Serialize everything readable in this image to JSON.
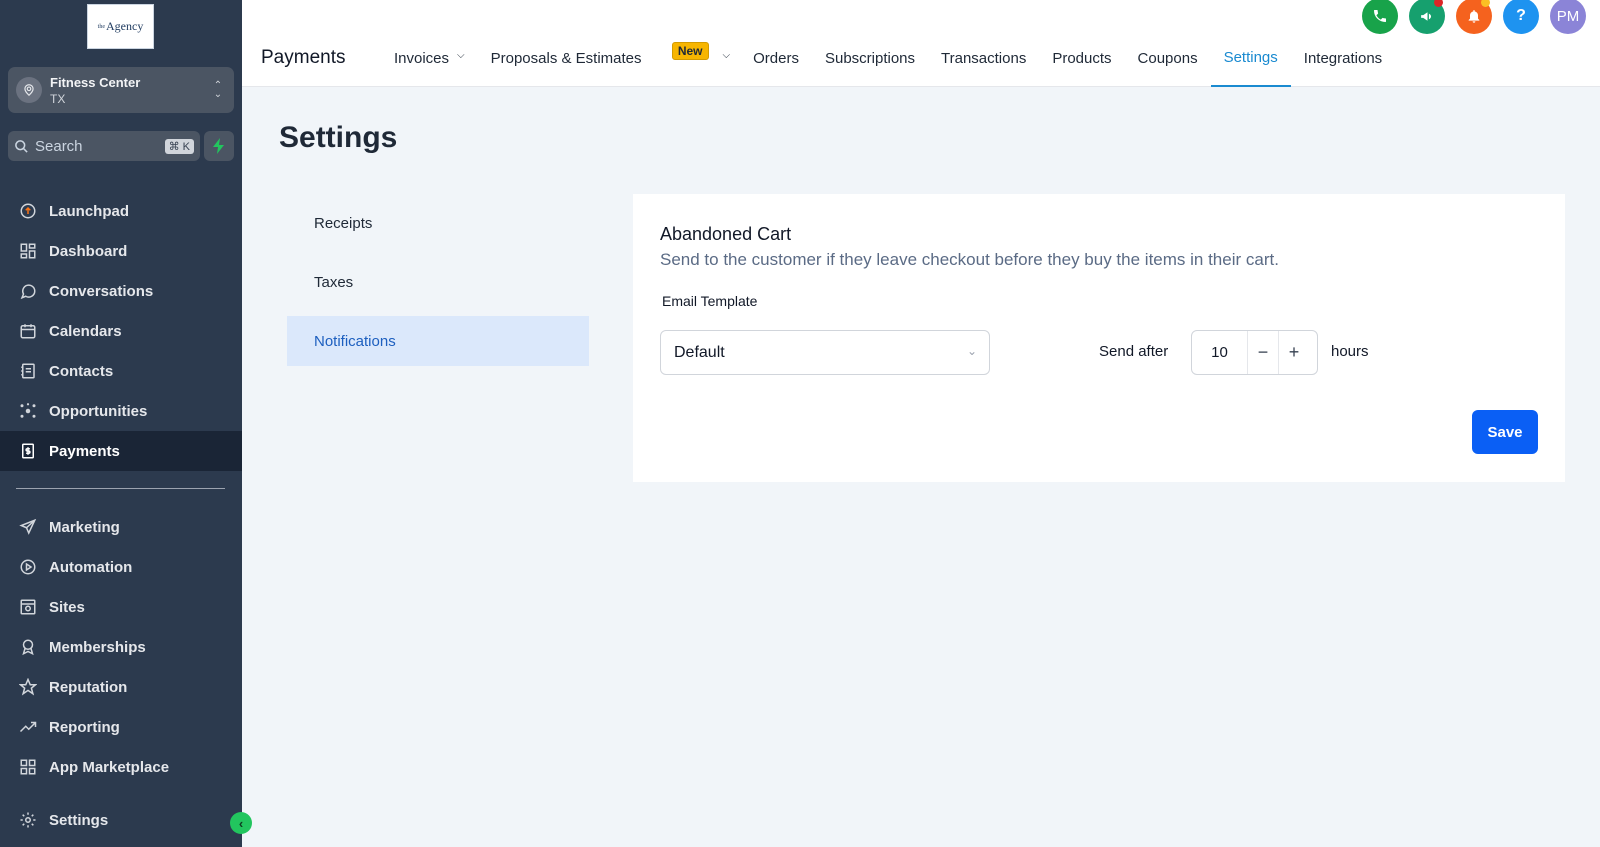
{
  "brand": {
    "logo_small": "the",
    "logo_text": "Agency"
  },
  "account": {
    "name": "Fitness Center",
    "location": "TX"
  },
  "search": {
    "placeholder": "Search",
    "shortcut": "⌘ K"
  },
  "sidebar": {
    "items": [
      {
        "label": "Launchpad",
        "icon": "launchpad-icon"
      },
      {
        "label": "Dashboard",
        "icon": "dashboard-icon"
      },
      {
        "label": "Conversations",
        "icon": "chat-icon"
      },
      {
        "label": "Calendars",
        "icon": "calendar-icon"
      },
      {
        "label": "Contacts",
        "icon": "contacts-icon"
      },
      {
        "label": "Opportunities",
        "icon": "opportunities-icon"
      },
      {
        "label": "Payments",
        "icon": "payments-icon",
        "active": true
      }
    ],
    "items2": [
      {
        "label": "Marketing",
        "icon": "send-icon"
      },
      {
        "label": "Automation",
        "icon": "automation-icon"
      },
      {
        "label": "Sites",
        "icon": "sites-icon"
      },
      {
        "label": "Memberships",
        "icon": "membership-icon"
      },
      {
        "label": "Reputation",
        "icon": "star-icon"
      },
      {
        "label": "Reporting",
        "icon": "reporting-icon"
      },
      {
        "label": "App Marketplace",
        "icon": "apps-icon"
      }
    ],
    "settings_label": "Settings"
  },
  "header": {
    "title": "Payments",
    "tabs": [
      {
        "label": "Invoices"
      },
      {
        "label": "Proposals & Estimates",
        "badge": "New"
      },
      {
        "label": "Orders"
      },
      {
        "label": "Subscriptions"
      },
      {
        "label": "Transactions"
      },
      {
        "label": "Products"
      },
      {
        "label": "Coupons"
      },
      {
        "label": "Settings",
        "active": true
      },
      {
        "label": "Integrations"
      }
    ],
    "avatar_initials": "PM",
    "help_glyph": "?"
  },
  "colors": {
    "sidebar_bg": "#2c3a4e",
    "accent": "#1a8ad0",
    "save_button": "#0a5ff5",
    "phone": "#18a34a",
    "announce": "#16a06e",
    "bell": "#f5621e",
    "help": "#1e93f0",
    "avatar": "#8b84d7"
  },
  "page": {
    "title": "Settings",
    "subnav": [
      {
        "label": "Receipts"
      },
      {
        "label": "Taxes"
      },
      {
        "label": "Notifications",
        "active": true
      }
    ]
  },
  "card": {
    "title": "Abandoned Cart",
    "description": "Send to the customer if they leave checkout before they buy the items in their cart.",
    "template_label": "Email Template",
    "template_value": "Default",
    "send_after_label": "Send after",
    "send_after_value": "10",
    "unit": "hours",
    "save_label": "Save"
  }
}
